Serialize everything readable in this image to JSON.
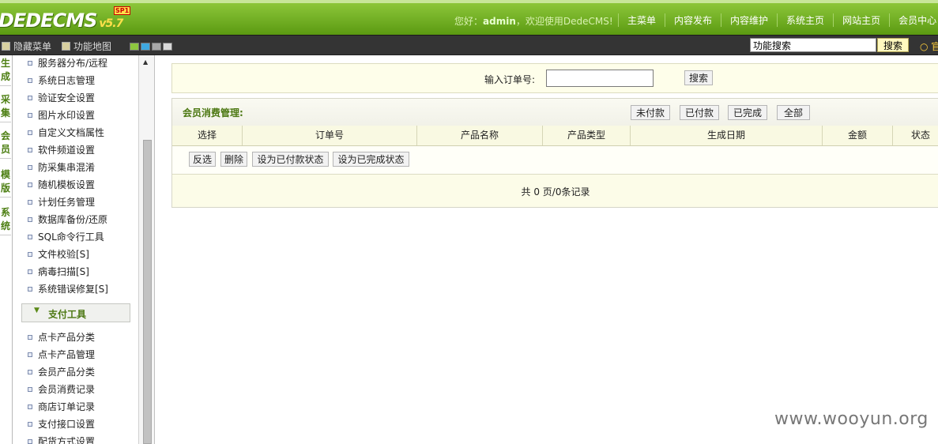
{
  "header": {
    "logo": "DEDECMS",
    "version": "v5.7",
    "sp_badge": "SP1",
    "welcome_prefix": "您好：",
    "username": "admin",
    "welcome_suffix": "，欢迎使用DedeCMS!",
    "nav": [
      "主菜单",
      "内容发布",
      "内容维护",
      "系统主页",
      "网站主页",
      "会员中心"
    ]
  },
  "toolbar": {
    "hide_menu": "隐藏菜单",
    "site_map": "功能地图",
    "swatch_colors": [
      "#8dc63f",
      "#3fa9e0",
      "#a8a8a8",
      "#d8d8d8"
    ],
    "search_value": "功能搜索",
    "search_button": "搜索",
    "right_text": "官"
  },
  "left_tabs": [
    "生成",
    "采集",
    "会员",
    "模版",
    "系统"
  ],
  "menu": {
    "system_items": [
      "服务器分布/远程",
      "系统日志管理",
      "验证安全设置",
      "图片水印设置",
      "自定义文档属性",
      "软件频道设置",
      "防采集串混淆",
      "随机模板设置",
      "计划任务管理",
      "数据库备份/还原",
      "SQL命令行工具",
      "文件校验[S]",
      "病毒扫描[S]",
      "系统错误修复[S]"
    ],
    "pay_group": "支付工具",
    "pay_items": [
      "点卡产品分类",
      "点卡产品管理",
      "会员产品分类",
      "会员消费记录",
      "商店订单记录",
      "支付接口设置",
      "配货方式设置"
    ]
  },
  "search_panel": {
    "label": "输入订单号:",
    "input_value": "",
    "button": "搜索"
  },
  "table_panel": {
    "title": "会员消费管理:",
    "filters": [
      "未付款",
      "已付款",
      "已完成",
      "全部"
    ],
    "columns": [
      "选择",
      "订单号",
      "产品名称",
      "产品类型",
      "生成日期",
      "金额",
      "状态"
    ],
    "actions": [
      "反选",
      "删除",
      "设为已付款状态",
      "设为已完成状态"
    ],
    "pager": "共 0 页/0条记录"
  },
  "watermark": "www.wooyun.org"
}
